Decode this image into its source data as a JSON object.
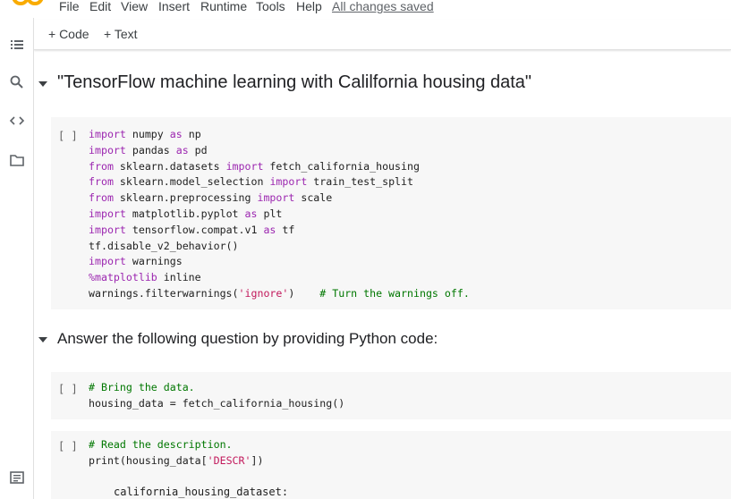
{
  "menu": {
    "items": [
      "File",
      "Edit",
      "View",
      "Insert",
      "Runtime",
      "Tools",
      "Help"
    ],
    "status": "All changes saved"
  },
  "toolbar": {
    "code_label": "+ Code",
    "text_label": "+ Text"
  },
  "sidebar": {
    "icons": [
      "table-of-contents-icon",
      "search-icon",
      "code-snippets-icon",
      "files-icon",
      "terminal-icon"
    ]
  },
  "sections": [
    {
      "title": "\"TensorFlow machine learning with Calilfornia housing data\""
    },
    {
      "title": "Answer the following question by providing Python code:"
    }
  ],
  "cells": [
    {
      "run_label": "[ ]",
      "lines": [
        [
          {
            "t": "kw",
            "v": "import"
          },
          {
            "t": "n",
            "v": " numpy "
          },
          {
            "t": "kw",
            "v": "as"
          },
          {
            "t": "n",
            "v": " np"
          }
        ],
        [
          {
            "t": "kw",
            "v": "import"
          },
          {
            "t": "n",
            "v": " pandas "
          },
          {
            "t": "kw",
            "v": "as"
          },
          {
            "t": "n",
            "v": " pd"
          }
        ],
        [
          {
            "t": "kw",
            "v": "from"
          },
          {
            "t": "n",
            "v": " sklearn.datasets "
          },
          {
            "t": "kw",
            "v": "import"
          },
          {
            "t": "n",
            "v": " fetch_california_housing"
          }
        ],
        [
          {
            "t": "kw",
            "v": "from"
          },
          {
            "t": "n",
            "v": " sklearn.model_selection "
          },
          {
            "t": "kw",
            "v": "import"
          },
          {
            "t": "n",
            "v": " train_test_split"
          }
        ],
        [
          {
            "t": "kw",
            "v": "from"
          },
          {
            "t": "n",
            "v": " sklearn.preprocessing "
          },
          {
            "t": "kw",
            "v": "import"
          },
          {
            "t": "n",
            "v": " scale"
          }
        ],
        [
          {
            "t": "kw",
            "v": "import"
          },
          {
            "t": "n",
            "v": " matplotlib.pyplot "
          },
          {
            "t": "kw",
            "v": "as"
          },
          {
            "t": "n",
            "v": " plt"
          }
        ],
        [
          {
            "t": "kw",
            "v": "import"
          },
          {
            "t": "n",
            "v": " tensorflow.compat.v1 "
          },
          {
            "t": "kw",
            "v": "as"
          },
          {
            "t": "n",
            "v": " tf"
          }
        ],
        [
          {
            "t": "n",
            "v": "tf.disable_v2_behavior()"
          }
        ],
        [
          {
            "t": "kw",
            "v": "import"
          },
          {
            "t": "n",
            "v": " warnings"
          }
        ],
        [
          {
            "t": "kw",
            "v": "%matplotlib"
          },
          {
            "t": "n",
            "v": " inline"
          }
        ],
        [
          {
            "t": "n",
            "v": "warnings.filterwarnings("
          },
          {
            "t": "str",
            "v": "'ignore'"
          },
          {
            "t": "n",
            "v": ")    "
          },
          {
            "t": "cmt",
            "v": "# Turn the warnings off."
          }
        ]
      ]
    },
    {
      "run_label": "[ ]",
      "lines": [
        [
          {
            "t": "cmt",
            "v": "# Bring the data."
          }
        ],
        [
          {
            "t": "n",
            "v": "housing_data = fetch_california_housing()"
          }
        ]
      ]
    },
    {
      "run_label": "[ ]",
      "lines": [
        [
          {
            "t": "cmt",
            "v": "# Read the description."
          }
        ],
        [
          {
            "t": "n",
            "v": "print(housing_data["
          },
          {
            "t": "str",
            "v": "'DESCR'"
          },
          {
            "t": "n",
            "v": "])"
          }
        ]
      ]
    }
  ],
  "output": {
    "first_line": "california_housing_dataset:"
  },
  "colors": {
    "keyword": "#9c27b0",
    "string": "#c2185b",
    "comment": "#007700",
    "cell_bg": "#f7f7f7"
  }
}
